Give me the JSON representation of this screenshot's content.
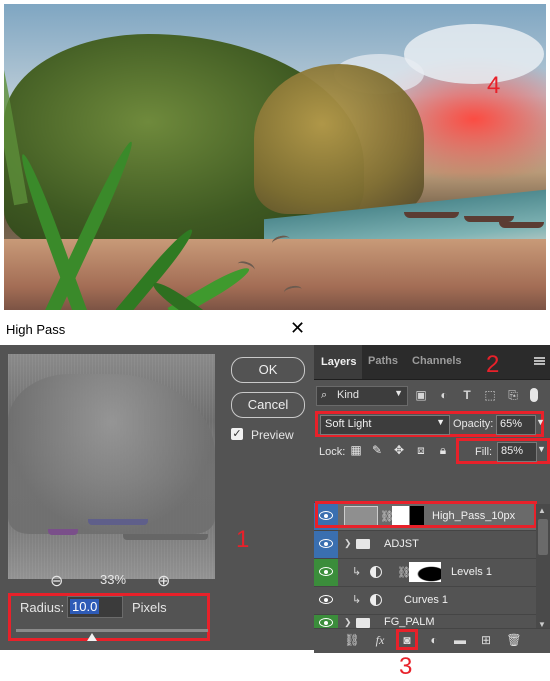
{
  "photo": {
    "annotation": "4"
  },
  "high_pass": {
    "title": "High Pass",
    "close_glyph": "✕",
    "ok_label": "OK",
    "cancel_label": "Cancel",
    "preview_label": "Preview",
    "preview_checked": true,
    "zoom_percent": "33%",
    "radius_label": "Radius:",
    "radius_value": "10.0",
    "radius_unit": "Pixels",
    "annotation": "1"
  },
  "layers_panel": {
    "tabs": [
      "Layers",
      "Paths",
      "Channels"
    ],
    "annotation_tabs": "2",
    "filter_kind": "Kind",
    "blend_mode": "Soft Light",
    "opacity_label": "Opacity:",
    "opacity_value": "65%",
    "lock_label": "Lock:",
    "fill_label": "Fill:",
    "fill_value": "85%",
    "layers": [
      {
        "name": "High_Pass_10px",
        "visible": true,
        "selected": true
      },
      {
        "name": "ADJST",
        "type": "group"
      },
      {
        "name": "Levels 1",
        "type": "adjustment",
        "clipped": true
      },
      {
        "name": "Curves 1",
        "type": "adjustment",
        "clipped": true
      },
      {
        "name": "FG_PALM",
        "type": "group"
      }
    ],
    "footer_icons": [
      "link-icon",
      "fx-icon",
      "layer-mask-icon",
      "adjustment-layer-icon",
      "group-folder-icon",
      "new-layer-icon",
      "trash-icon"
    ],
    "annotation_footer": "3",
    "fx_label": "fx"
  },
  "colors": {
    "annotation_red": "#e8212a",
    "eye_green": "#3b8d3b",
    "eye_blue": "#3a6fb0"
  }
}
